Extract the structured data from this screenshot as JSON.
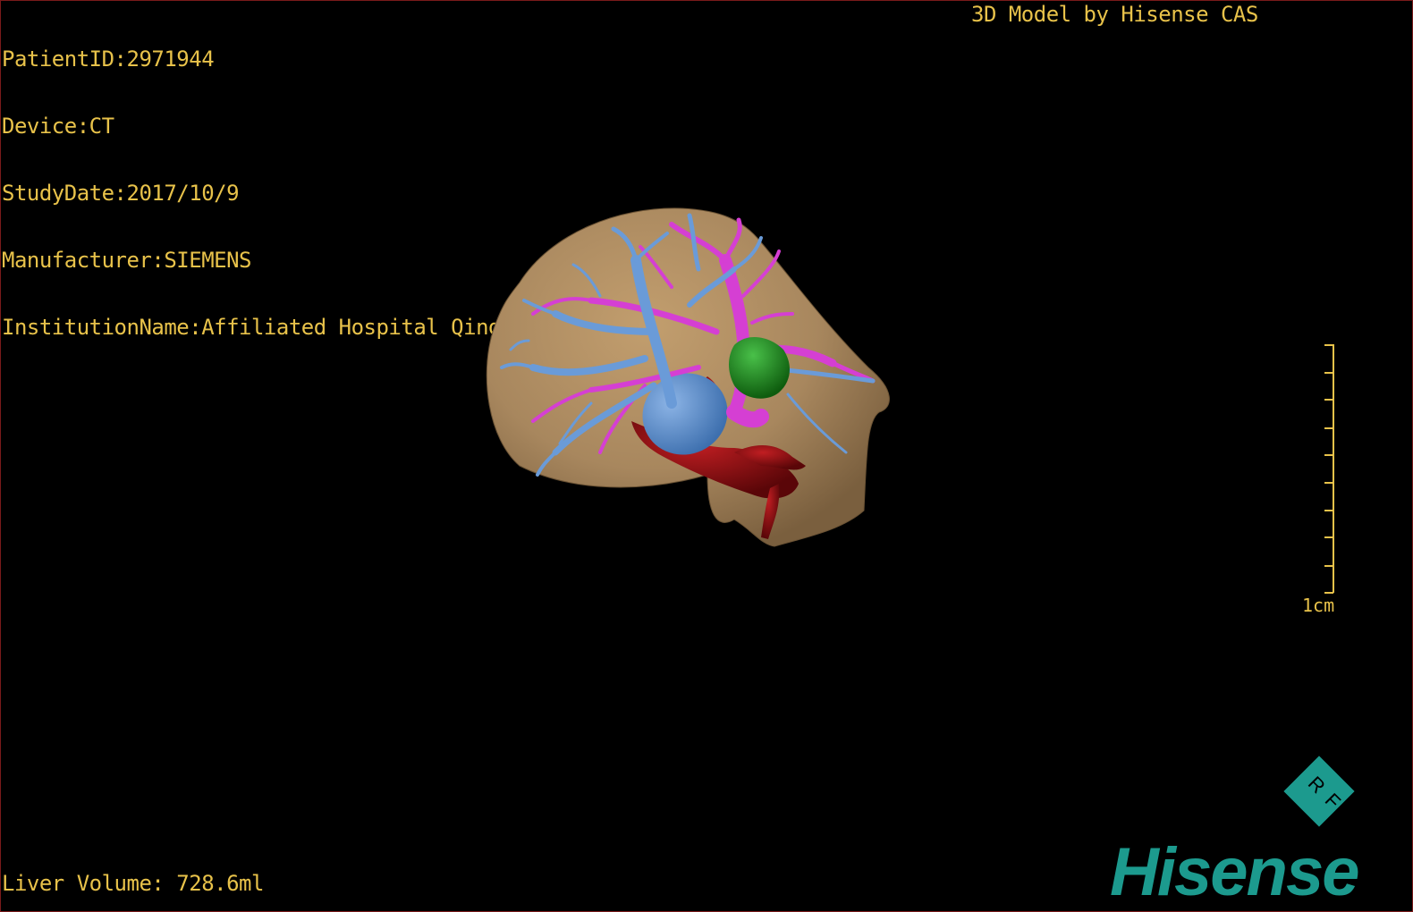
{
  "info": {
    "patient_id": "PatientID:2971944",
    "device": "Device:CT",
    "study_date": "StudyDate:2017/10/9",
    "manufacturer": "Manufacturer:SIEMENS",
    "institution": "InstitutionName:Affiliated Hospital Qingdao University-C"
  },
  "header_right": "3D Model by Hisense CAS",
  "footer": {
    "liver_volume": "Liver Volume: 728.6ml"
  },
  "scale": {
    "label": "1cm"
  },
  "logo": {
    "word": "Hisense",
    "mark_letters": "RF"
  },
  "colors": {
    "overlay_text": "#e8c24a",
    "liver": "#a8875e",
    "portal_vein": "#5b8fd0",
    "hepatic_artery_branches": "#d53fd3",
    "artery": "#9c0d12",
    "lesion": "#1e8a1e",
    "logo": "#1c9a8e"
  },
  "icons": {
    "logo_mark": "rf-diamond-icon"
  }
}
